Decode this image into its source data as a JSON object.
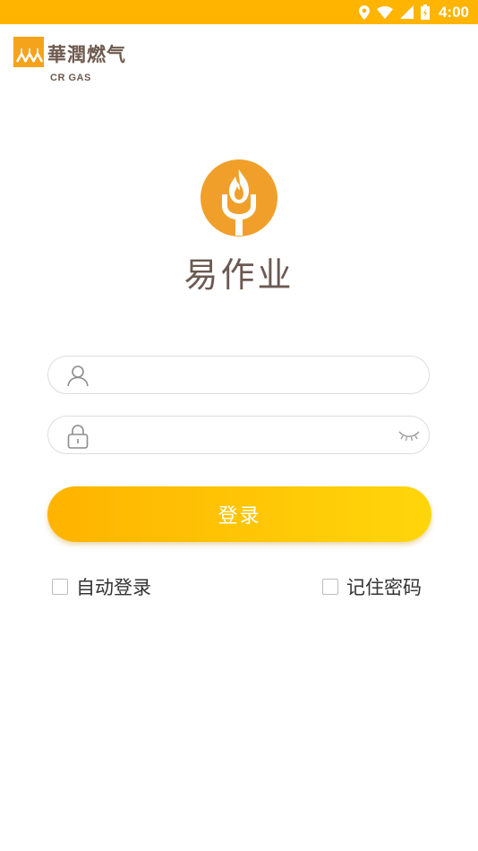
{
  "status_bar": {
    "time": "4:00"
  },
  "brand": {
    "name_cn": "華潤燃气",
    "name_en": "CR GAS",
    "color": "#F5A31A"
  },
  "app": {
    "name": "易作业",
    "logo_color": "#F0A02A"
  },
  "login_form": {
    "username": {
      "value": "",
      "placeholder": "",
      "icon": "user-icon"
    },
    "password": {
      "value": "",
      "placeholder": "",
      "icon": "lock-icon",
      "toggle_icon": "eye-closed-icon"
    },
    "submit_label": "登录",
    "auto_login": {
      "label": "自动登录",
      "checked": false
    },
    "remember_password": {
      "label": "记住密码",
      "checked": false
    }
  },
  "colors": {
    "accent": "#FFB400",
    "button_gradient_start": "#FFB300",
    "button_gradient_end": "#FFD60A"
  }
}
